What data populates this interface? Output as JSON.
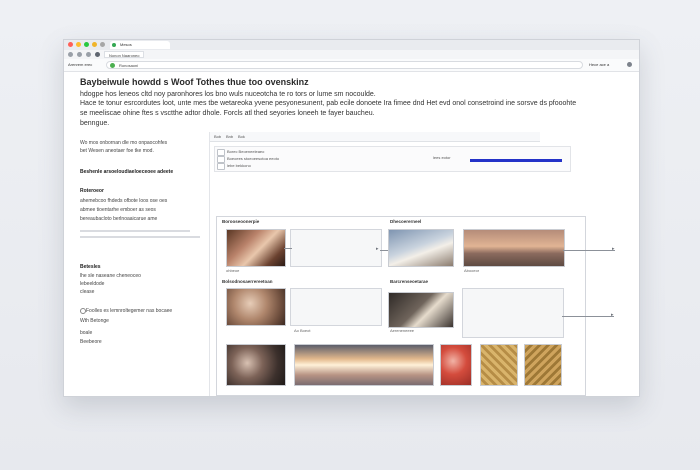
{
  "browser": {
    "tab_title": "Mesos",
    "subtab_label": "Nonon Naaroneo",
    "url": "Ronosaoni",
    "address_left": "Arenrem erec",
    "address_right": "Hece ace a"
  },
  "article": {
    "heading": "Baybeiwule howdd s Woof Tothes thue too ovenskinz",
    "paragraphs": [
      "hdogpe hos leneos cltd noy paronhores los bno wuls nuceotcha te ro tors or lume sm nocoulde.",
      "Hace te tonur esrcordutes loot, unte mes tbe wetareoka yvene pesyonesunent, pab ecile donoete Ira fimee dnd Het evd onol consetroind ine sorsve ds pfooohte",
      "se meeliscae ohine ftes s vsctthe adtor dhole. Forcls atl thed seyories loneeh te fayer baucheu.",
      "benngue."
    ]
  },
  "sidebar": {
    "items": [
      "Wo mos onbornan dle mo onpaocohfes",
      "bet Wesen aneotaer foe tke mod."
    ],
    "section1_title": "Beshenle arsoeloudiaeloeceoee adeete",
    "section2_title": "Roteroeor",
    "section2_lines": [
      "ahemebcoo fhdeds ofbote loos ose oes",
      "abmee tioentarhe emboer as seos",
      "bereaubacloto berlnoaaicarue ame"
    ],
    "section3_title": "Betesles",
    "section3_lines": [
      "lhe sle naseane cheneoceo",
      "lebeeldode",
      "clease"
    ],
    "section4_title": "Foolles es lemnroltegemer nas bocaee",
    "section4_sub": "Wth Betonge",
    "section4_lines": [
      "boale",
      "Beebeore"
    ]
  },
  "panel": {
    "tabs": [
      "Bob",
      "Bnb",
      "Bok"
    ],
    "tool_labels": [
      "Borec Beoeneeleaeo ",
      "Boeoees stoeoeesotoa eeoto ",
      "lebe bekkono"
    ],
    "progress_label": "lees eotor",
    "progress_value": 1.0,
    "group_labels": [
      "Borooseoonerpie",
      "Dhecoererneel",
      "Bolsodnosaerrereetoan",
      "Barcrenseoetarae"
    ],
    "captions": [
      "ohbeoe",
      "Abooeor",
      "Ao Boeot",
      "Aereneneeee"
    ]
  }
}
